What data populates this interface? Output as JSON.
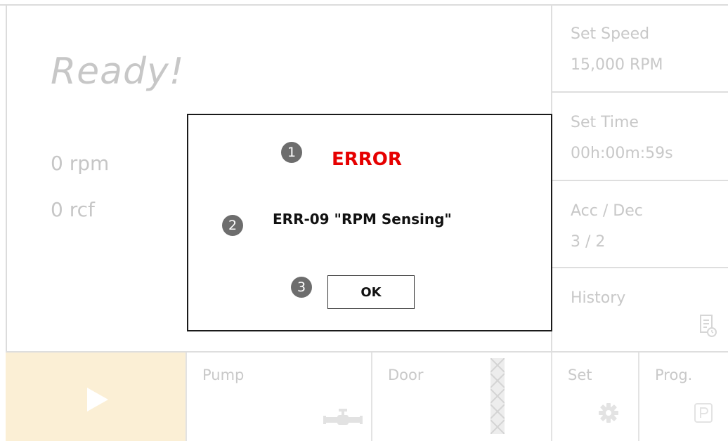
{
  "status": {
    "title": "Ready!",
    "rpm": "0 rpm",
    "rcf": "0 rcf"
  },
  "settings": [
    {
      "label": "Set Speed",
      "value": "15,000 RPM"
    },
    {
      "label": "Set Time",
      "value": "00h:00m:59s"
    },
    {
      "label": "Acc / Dec",
      "value": "3 / 2"
    }
  ],
  "history": {
    "label": "History",
    "icon": "history-list-icon"
  },
  "bottom_bar": {
    "play_icon": "play-icon",
    "pump": {
      "label": "Pump",
      "icon": "pump-valve-icon"
    },
    "door": {
      "label": "Door",
      "icon": "door-icon"
    },
    "set": {
      "label": "Set",
      "icon": "gear-icon"
    },
    "prog": {
      "label": "Prog.",
      "icon": "program-p-icon"
    }
  },
  "dialog": {
    "title": "ERROR",
    "message": "ERR-09 \"RPM Sensing\"",
    "ok_label": "OK",
    "markers": [
      "1",
      "2",
      "3"
    ]
  },
  "colors": {
    "error_red": "#e60000",
    "play_background": "#fbefd5",
    "inactive_text": "#c8c8c8",
    "marker_gray": "#6d6d6d"
  }
}
